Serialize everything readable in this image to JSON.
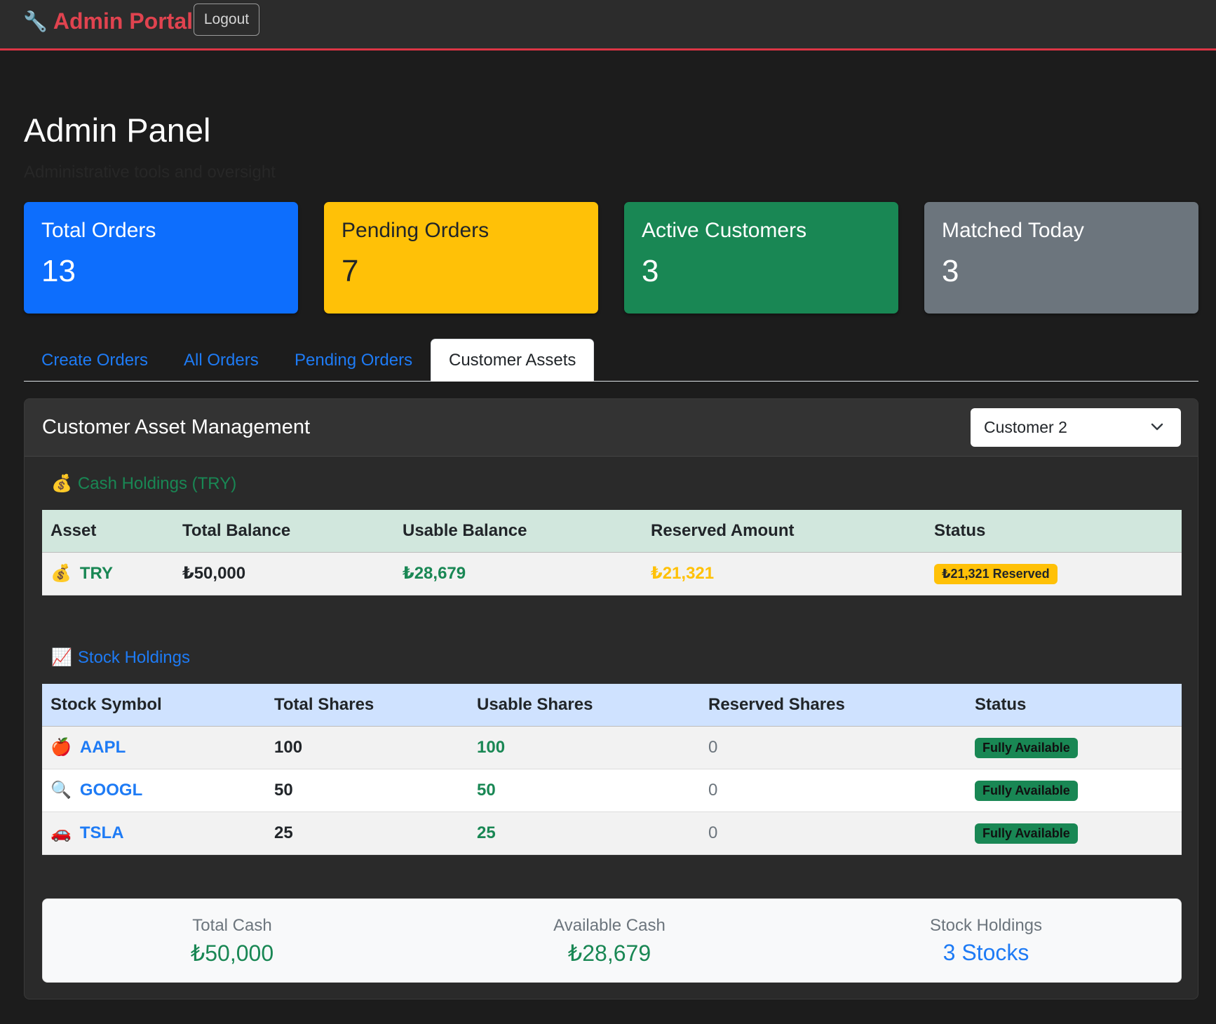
{
  "nav": {
    "brand_icon": "🔧",
    "brand": "Admin Portal",
    "logout": "Logout"
  },
  "page": {
    "title": "Admin Panel",
    "subtitle": "Administrative tools and oversight"
  },
  "stats": [
    {
      "label": "Total Orders",
      "value": "13",
      "color": "#0d6efd"
    },
    {
      "label": "Pending Orders",
      "value": "7",
      "color": "#ffc107"
    },
    {
      "label": "Active Customers",
      "value": "3",
      "color": "#198754"
    },
    {
      "label": "Matched Today",
      "value": "3",
      "color": "#6c757d"
    }
  ],
  "tabs": [
    {
      "label": "Create Orders",
      "active": false
    },
    {
      "label": "All Orders",
      "active": false
    },
    {
      "label": "Pending Orders",
      "active": false
    },
    {
      "label": "Customer Assets",
      "active": true
    }
  ],
  "card": {
    "title": "Customer Asset Management",
    "customer_select": "Customer 2"
  },
  "cash": {
    "icon": "💰",
    "title": "Cash Holdings (TRY)",
    "headers": [
      "Asset",
      "Total Balance",
      "Usable Balance",
      "Reserved Amount",
      "Status"
    ],
    "rows": [
      {
        "icon": "💰",
        "asset": "TRY",
        "total": "₺50,000",
        "usable": "₺28,679",
        "reserved": "₺21,321",
        "status": "₺21,321 Reserved"
      }
    ]
  },
  "stocks": {
    "icon": "📈",
    "title": "Stock Holdings",
    "headers": [
      "Stock Symbol",
      "Total Shares",
      "Usable Shares",
      "Reserved Shares",
      "Status"
    ],
    "rows": [
      {
        "icon": "🍎",
        "symbol": "AAPL",
        "total": "100",
        "usable": "100",
        "reserved": "0",
        "status": "Fully Available"
      },
      {
        "icon": "🔍",
        "symbol": "GOOGL",
        "total": "50",
        "usable": "50",
        "reserved": "0",
        "status": "Fully Available"
      },
      {
        "icon": "🚗",
        "symbol": "TSLA",
        "total": "25",
        "usable": "25",
        "reserved": "0",
        "status": "Fully Available"
      }
    ]
  },
  "summary": [
    {
      "label": "Total Cash",
      "value": "₺50,000",
      "color": "#198754"
    },
    {
      "label": "Available Cash",
      "value": "₺28,679",
      "color": "#198754"
    },
    {
      "label": "Stock Holdings",
      "value": "3 Stocks",
      "color": "#1e7bf5"
    }
  ]
}
